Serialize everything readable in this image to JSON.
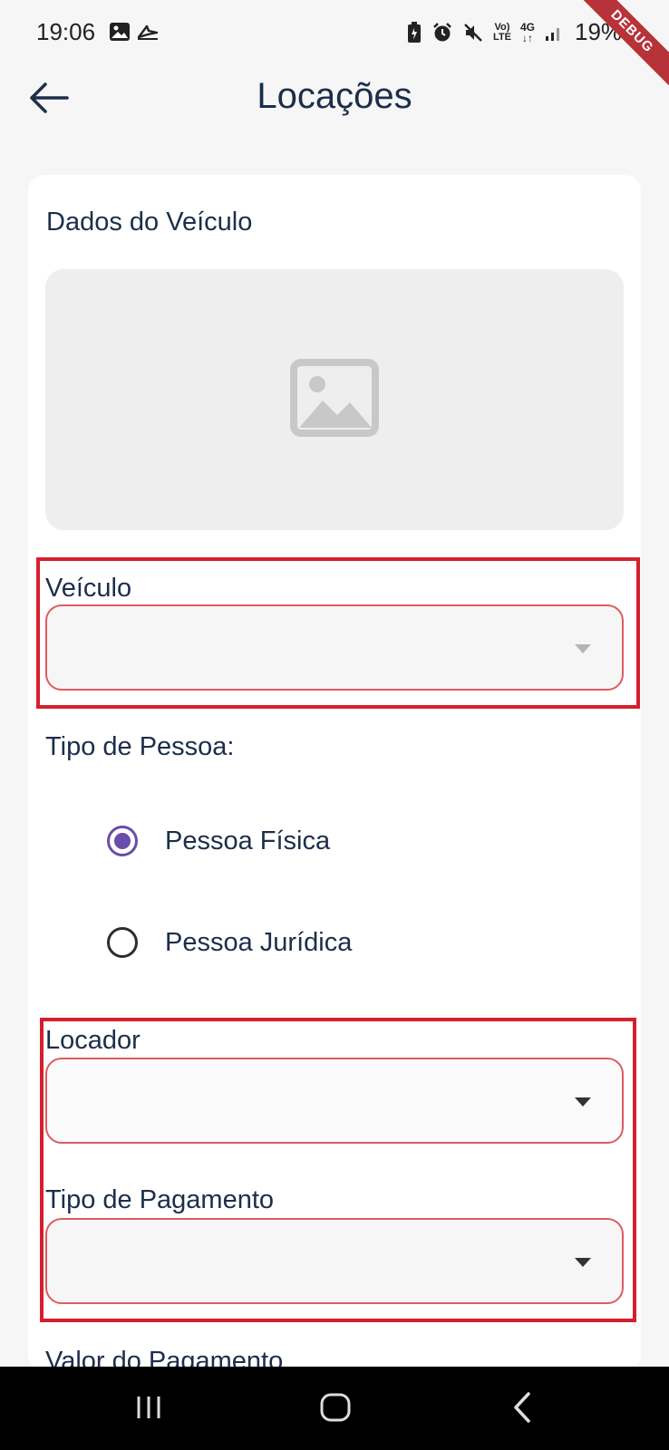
{
  "status_bar": {
    "time": "19:06",
    "battery_text": "19%",
    "network_label": "4G",
    "volte_label": "Vo) LTE"
  },
  "debug_banner": {
    "label": "DEBUG"
  },
  "app_bar": {
    "title": "Locações",
    "back_icon": "arrow-left-icon"
  },
  "card": {
    "section_title": "Dados do Veículo",
    "image_icon": "image-placeholder-icon"
  },
  "fields": {
    "veiculo": {
      "label": "Veículo",
      "value": "",
      "enabled": false
    },
    "tipo_pessoa": {
      "label": "Tipo de Pessoa:",
      "options": [
        {
          "label": "Pessoa Física",
          "checked": true
        },
        {
          "label": "Pessoa Jurídica",
          "checked": false
        }
      ]
    },
    "locador": {
      "label": "Locador",
      "value": "",
      "enabled": true
    },
    "tipo_pagamento": {
      "label": "Tipo de Pagamento",
      "value": "",
      "enabled": true
    },
    "valor_pagamento": {
      "label": "Valor do Pagamento"
    }
  },
  "nav_bar": {
    "recents_icon": "recents-icon",
    "home_icon": "home-icon",
    "back_icon": "back-chevron-icon"
  },
  "colors": {
    "primary_text": "#1c2e4a",
    "radio_accent": "#6a4cab",
    "error_border": "#de5b60",
    "highlight": "#d4202e",
    "debug_ribbon": "#b8323a"
  }
}
